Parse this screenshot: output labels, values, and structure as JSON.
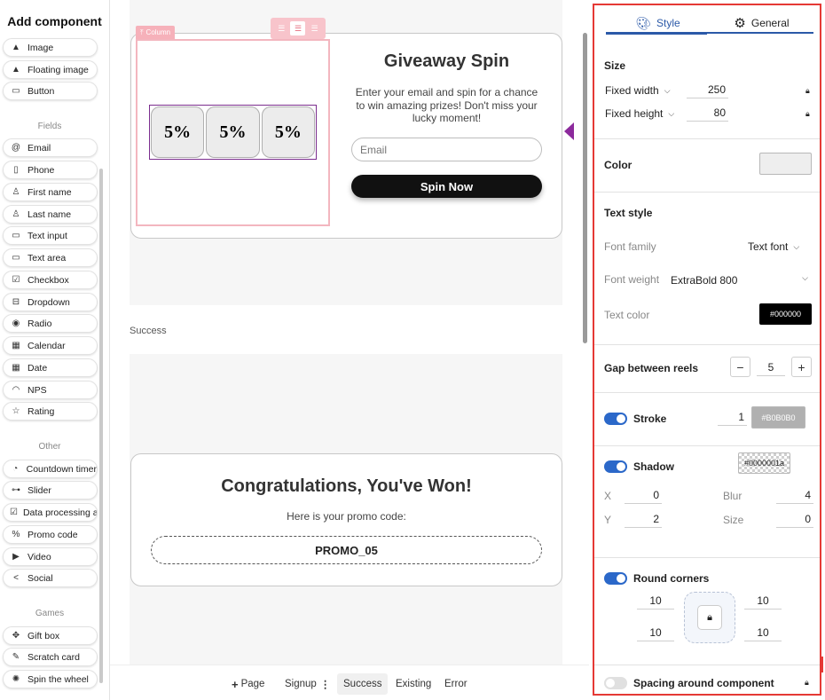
{
  "sidebar": {
    "title": "Add component",
    "items_top": [
      {
        "label": "Image",
        "icon": "image-icon"
      },
      {
        "label": "Floating image",
        "icon": "floating-image-icon"
      },
      {
        "label": "Button",
        "icon": "button-icon"
      }
    ],
    "fields_label": "Fields",
    "fields": [
      {
        "label": "Email",
        "icon": "at-icon"
      },
      {
        "label": "Phone",
        "icon": "phone-icon"
      },
      {
        "label": "First name",
        "icon": "person-icon"
      },
      {
        "label": "Last name",
        "icon": "person-icon"
      },
      {
        "label": "Text input",
        "icon": "text-input-icon"
      },
      {
        "label": "Text area",
        "icon": "text-area-icon"
      },
      {
        "label": "Checkbox",
        "icon": "checkbox-icon"
      },
      {
        "label": "Dropdown",
        "icon": "dropdown-icon"
      },
      {
        "label": "Radio",
        "icon": "radio-icon"
      },
      {
        "label": "Calendar",
        "icon": "calendar-icon"
      },
      {
        "label": "Date",
        "icon": "date-icon"
      },
      {
        "label": "NPS",
        "icon": "gauge-icon"
      },
      {
        "label": "Rating",
        "icon": "star-icon"
      }
    ],
    "other_label": "Other",
    "other": [
      {
        "label": "Countdown timer",
        "icon": "timer-icon"
      },
      {
        "label": "Slider",
        "icon": "slider-icon"
      },
      {
        "label": "Data processing a",
        "icon": "checkbox-icon"
      },
      {
        "label": "Promo code",
        "icon": "percent-icon"
      },
      {
        "label": "Video",
        "icon": "play-icon"
      },
      {
        "label": "Social",
        "icon": "share-icon"
      }
    ],
    "games_label": "Games",
    "games": [
      {
        "label": "Gift box",
        "icon": "gift-icon"
      },
      {
        "label": "Scratch card",
        "icon": "scratch-icon"
      },
      {
        "label": "Spin the wheel",
        "icon": "wheel-icon"
      }
    ]
  },
  "canvas": {
    "column_tag": "Column",
    "reels": [
      "5%",
      "5%",
      "5%"
    ],
    "giveaway_title": "Giveaway Spin",
    "giveaway_desc": "Enter your email and spin for a chance to win amazing prizes! Don't miss your lucky moment!",
    "email_placeholder": "Email",
    "spin_button": "Spin Now",
    "success_label": "Success",
    "congrats_title": "Congratulations, You've Won!",
    "promo_text": "Here is your promo code:",
    "promo_code": "PROMO_05"
  },
  "bottom_tabs": {
    "add_page": "Page",
    "signup": "Signup",
    "success": "Success",
    "existing": "Existing",
    "error": "Error"
  },
  "panel": {
    "tab_style": "Style",
    "tab_general": "General",
    "size_title": "Size",
    "fixed_width_label": "Fixed width",
    "fixed_width": "250",
    "fixed_height_label": "Fixed height",
    "fixed_height": "80",
    "color_title": "Color",
    "color_value": "#EEEEEE",
    "text_style_title": "Text style",
    "font_family_label": "Font family",
    "font_family": "Text font",
    "font_weight_label": "Font weight",
    "font_weight": "ExtraBold 800",
    "text_color_label": "Text color",
    "text_color": "#000000",
    "gap_title": "Gap between reels",
    "gap_value": "5",
    "stroke_title": "Stroke",
    "stroke_width": "1",
    "stroke_color": "#B0B0B0",
    "shadow_title": "Shadow",
    "shadow_color": "#0000001a",
    "shadow_x_label": "X",
    "shadow_x": "0",
    "shadow_y_label": "Y",
    "shadow_y": "2",
    "shadow_blur_label": "Blur",
    "shadow_blur": "4",
    "shadow_size_label": "Size",
    "shadow_size": "0",
    "round_corners_title": "Round corners",
    "corner_tl": "10",
    "corner_tr": "10",
    "corner_bl": "10",
    "corner_br": "10",
    "spacing_title": "Spacing around component"
  },
  "colors": {
    "accent": "#2b59a8",
    "selection": "#e53935",
    "reel_bg": "#ececec",
    "reel_border": "#b0b0b0",
    "reel_frame": "#7b2d8e"
  }
}
